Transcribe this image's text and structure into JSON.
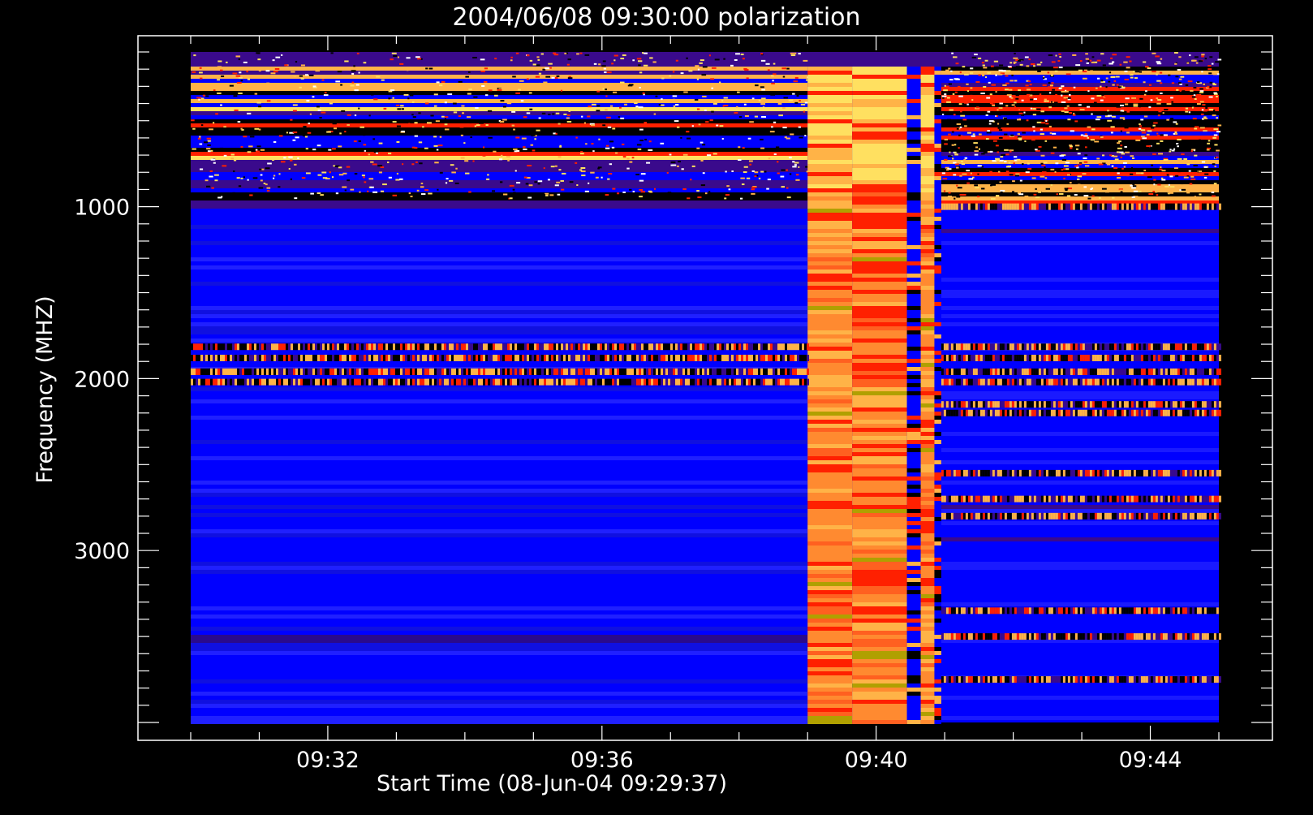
{
  "chart_data": {
    "type": "heatmap",
    "title": "2004/06/08 09:30:00 polarization",
    "xlabel": "Start Time (08-Jun-04 09:29:37)",
    "ylabel": "Frequency (MHZ)",
    "x_ticks": [
      "09:32",
      "09:36",
      "09:40",
      "09:44"
    ],
    "y_ticks": [
      "1000",
      "2000",
      "3000"
    ],
    "x_range_min": [
      30,
      45
    ],
    "y_range_mhz": [
      100,
      4000
    ],
    "colormap": [
      "#000000",
      "#3a0a8c",
      "#0000ff",
      "#1a1aff",
      "#ff2000",
      "#ff8a30",
      "#ffb347",
      "#ffe060",
      "#b0a000"
    ],
    "background_color": "#0000ff",
    "segments": [
      {
        "t_start": 30.0,
        "t_end": 39.0,
        "state": "quiet"
      },
      {
        "t_start": 39.0,
        "t_end": 39.65,
        "state": "burst"
      },
      {
        "t_start": 39.65,
        "t_end": 40.45,
        "state": "burst"
      },
      {
        "t_start": 40.45,
        "t_end": 40.65,
        "state": "mixed"
      },
      {
        "t_start": 40.65,
        "t_end": 40.85,
        "state": "burst"
      },
      {
        "t_start": 40.85,
        "t_end": 40.95,
        "state": "mixed"
      },
      {
        "t_start": 40.95,
        "t_end": 45.0,
        "state": "banded"
      }
    ],
    "interference_bands_mhz": [
      1000,
      1815,
      1880,
      1960,
      2020,
      2150,
      2200,
      2550,
      2700,
      2800,
      3350,
      3500,
      3750
    ]
  }
}
